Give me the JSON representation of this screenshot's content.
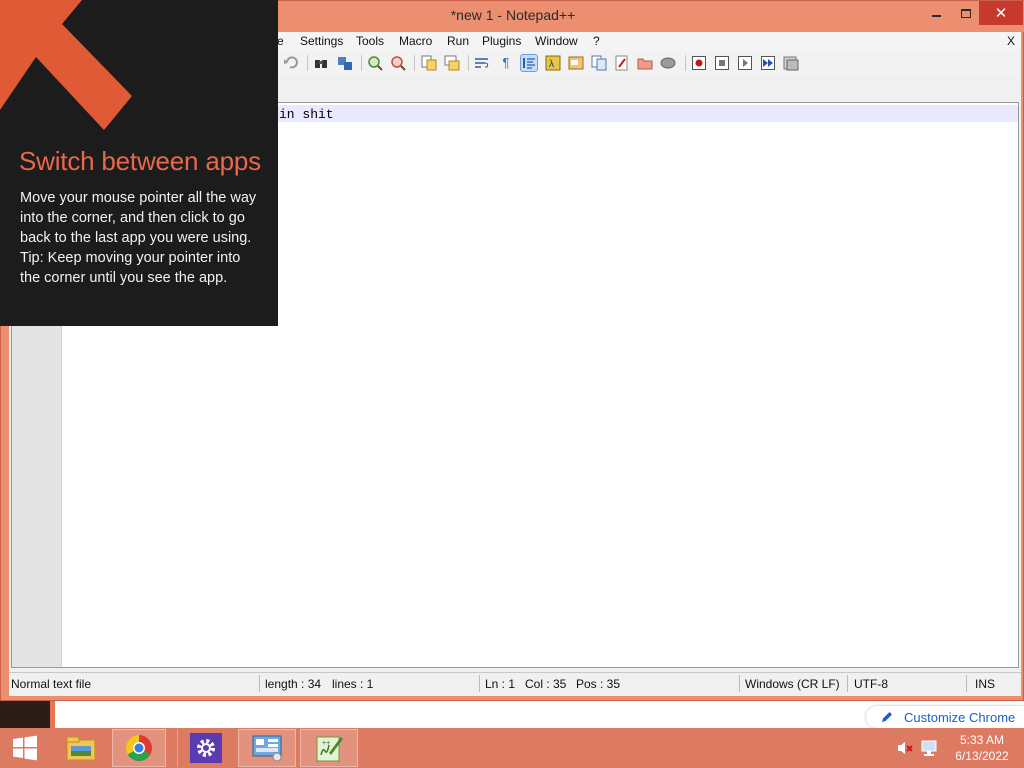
{
  "window": {
    "title": "*new 1 - Notepad++",
    "close_glyph": "✕"
  },
  "menubar": {
    "items": [
      "e",
      "Settings",
      "Tools",
      "Macro",
      "Run",
      "Plugins",
      "Window",
      "?"
    ],
    "close_x": "X"
  },
  "toolbar": {
    "icons": [
      "undo-icon",
      "redo-icon",
      "find-icon",
      "replace-icon",
      "zoom-in-icon",
      "zoom-out-icon",
      "sync-vertical-icon",
      "sync-horizontal-icon",
      "word-wrap-icon",
      "show-all-chars-icon",
      "indent-guide-icon",
      "user-defined-language-icon",
      "doc-map-icon",
      "function-list-icon",
      "folder-workspace-icon",
      "monitoring-icon",
      "record-macro-icon",
      "stop-macro-icon",
      "play-macro-icon",
      "run-macro-multiple-icon",
      "save-macro-icon"
    ],
    "paragraph_glyph": "¶"
  },
  "editor": {
    "visible_text": "in shit"
  },
  "statusbar": {
    "file_type": "Normal text file",
    "length": "length : 34",
    "lines": "lines : 1",
    "ln": "Ln : 1",
    "col": "Col : 35",
    "pos": "Pos : 35",
    "eol": "Windows (CR LF)",
    "encoding": "UTF-8",
    "mode": "INS"
  },
  "tip": {
    "title": "Switch between apps",
    "body": "Move your mouse pointer all the way into the corner, and then click to go back to the last app you were using.",
    "tip": "Tip: Keep moving your pointer into the corner until you see the app."
  },
  "chrome": {
    "customize_label": "Customize Chrome"
  },
  "taskbar": {
    "pinned": [
      "start-icon",
      "file-explorer-icon",
      "chrome-icon",
      "settings-icon",
      "control-panel-icon",
      "notepad-plus-plus-icon"
    ],
    "time": "5:33 AM",
    "date": "6/13/2022"
  },
  "colors": {
    "accent": "#e8684a",
    "window_frame": "#ec8f70",
    "close_button": "#c7392c",
    "tip_background": "#1c1c1c",
    "link_blue": "#1a5fd0"
  }
}
